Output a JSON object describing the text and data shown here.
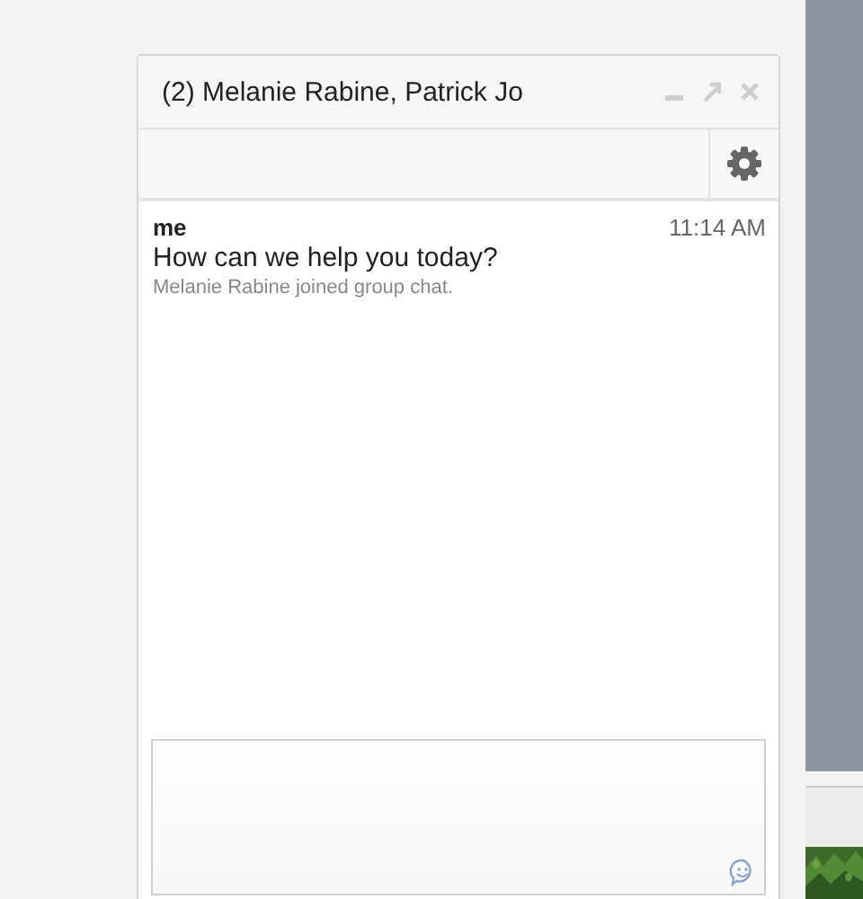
{
  "chat_window": {
    "title": "(2) Melanie Rabine, Patrick Jo",
    "messages": [
      {
        "kind": "message",
        "sender": "me",
        "time": "11:14 AM",
        "text": "How can we help you today?"
      },
      {
        "kind": "notice",
        "text": "Melanie Rabine joined group chat."
      }
    ]
  }
}
